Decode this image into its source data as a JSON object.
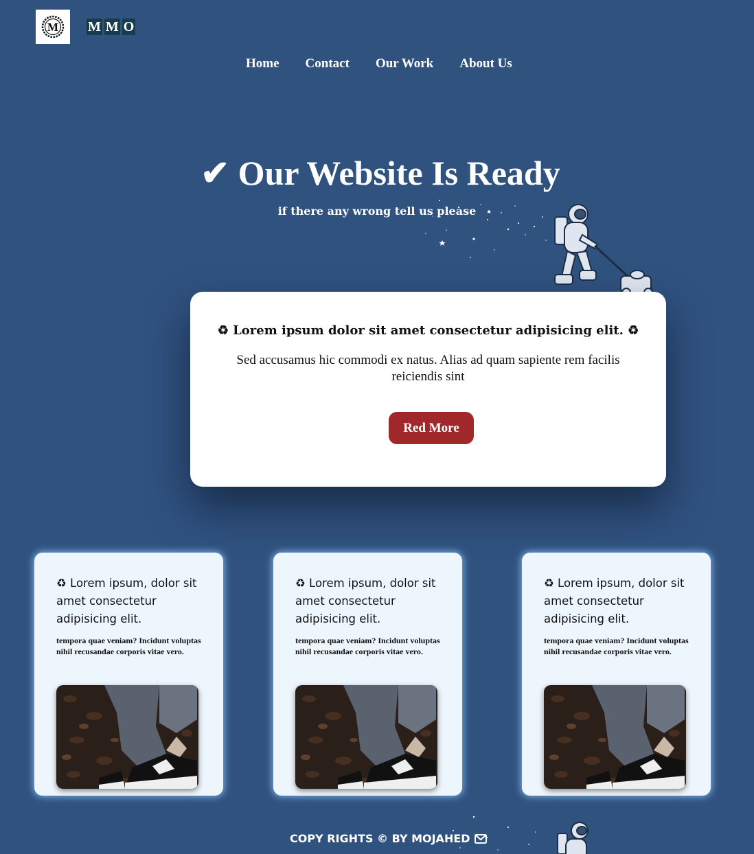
{
  "header": {
    "logo_letter": "M",
    "brand_letters": [
      "M",
      "M",
      "O"
    ]
  },
  "nav": {
    "items": [
      "Home",
      "Contact",
      "Our Work",
      "About Us"
    ]
  },
  "hero": {
    "title": "✔ Our Website Is Ready",
    "subtitle": "if there any wrong tell us please"
  },
  "main_card": {
    "title": "♻ Lorem ipsum dolor sit amet consectetur adipisicing elit. ♻",
    "text": "Sed accusamus hic commodi ex natus. Alias ad quam sapiente rem facilis reiciendis sint",
    "button": "Red More"
  },
  "cards": [
    {
      "title": "♻ Lorem ipsum, dolor sit amet consectetur adipisicing elit.",
      "text": "tempora quae veniam? Incidunt voluptas nihil recusandae corporis vitae vero."
    },
    {
      "title": "♻ Lorem ipsum, dolor sit amet consectetur adipisicing elit.",
      "text": "tempora quae veniam? Incidunt voluptas nihil recusandae corporis vitae vero."
    },
    {
      "title": "♻ Lorem ipsum, dolor sit amet consectetur adipisicing elit.",
      "text": "tempora quae veniam? Incidunt voluptas nihil recusandae corporis vitae vero."
    }
  ],
  "footer": {
    "text": "COPY RIGHTS © BY MOJAHED",
    "icon": "mail-icon"
  },
  "colors": {
    "background": "#30527f",
    "button": "#a0282a",
    "card": "#edf6fd",
    "brand_tile": "#173c4c"
  }
}
